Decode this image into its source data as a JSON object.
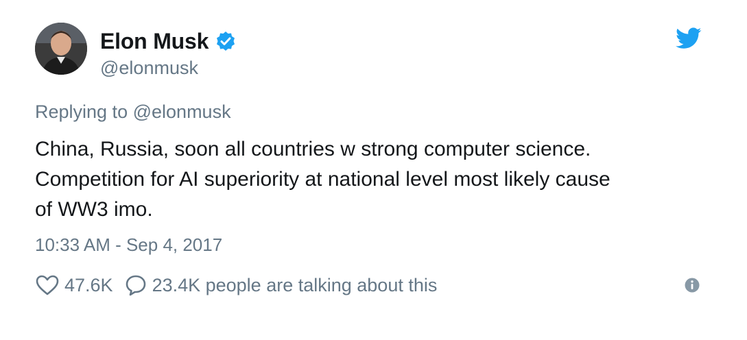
{
  "author": {
    "name": "Elon Musk",
    "handle": "@elonmusk",
    "verified": true
  },
  "tweet": {
    "reply_prefix": "Replying to",
    "reply_to": "@elonmusk",
    "lines": [
      "China, Russia, soon all countries w strong computer science.",
      "Competition for AI superiority at national level most likely cause",
      "of WW3 imo."
    ],
    "timestamp": "10:33 AM - Sep 4, 2017"
  },
  "actions": {
    "like_count": "47.6K",
    "talk_text": "23.4K people are talking about this"
  },
  "icons": {
    "like": "heart-icon",
    "reply": "speech-bubble-icon",
    "info": "info-icon",
    "brand": "twitter-bird-icon",
    "verified": "verified-badge-icon"
  },
  "colors": {
    "brand": "#1da1f2",
    "text": "#14171a",
    "muted": "#657786"
  }
}
